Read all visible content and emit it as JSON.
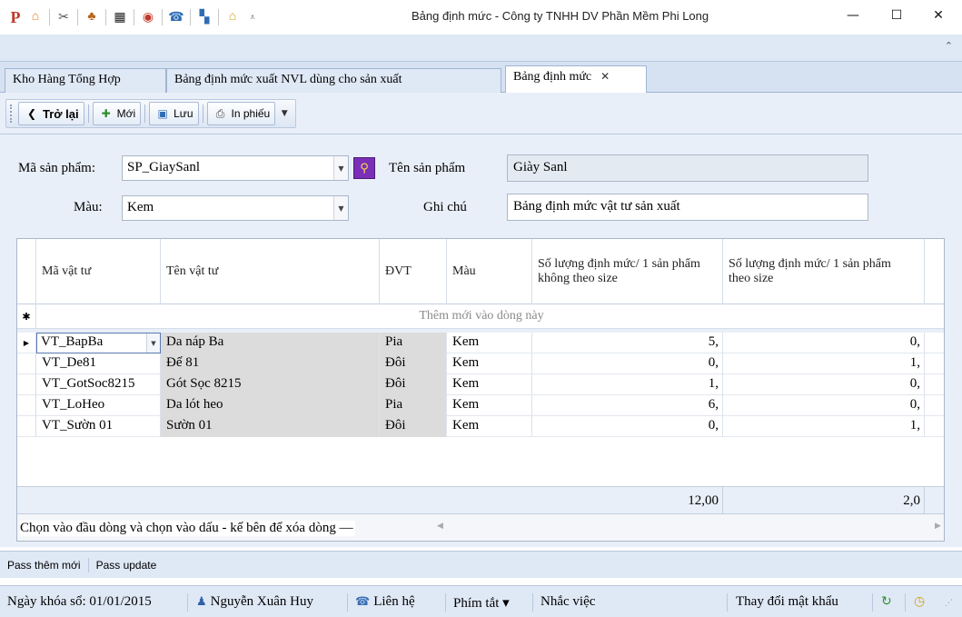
{
  "window": {
    "title": "Bảng định mức - Công ty TNHH DV Phần Mềm Phi Long",
    "minimize": "—",
    "maximize": "☐",
    "close": "✕",
    "quick_access_icons": [
      "app-logo-icon",
      "home-icon",
      "scissors-icon",
      "people-icon",
      "movie-icon",
      "eye-icon",
      "phone-icon",
      "windows-icon",
      "house-icon",
      "customize-icon"
    ]
  },
  "ribbon": {
    "collapse_glyph": "⌃"
  },
  "tabs": [
    {
      "label": "Kho Hàng Tổng Hợp",
      "active": false
    },
    {
      "label": "Bảng định mức xuất NVL dùng cho sản xuất",
      "active": false
    },
    {
      "label": "Bảng định mức",
      "active": true,
      "close": "✕"
    }
  ],
  "toolbar": {
    "back_label": "Trở lại",
    "new_label": "Mới",
    "save_label": "Lưu",
    "print_label": "In phiếu"
  },
  "form": {
    "product_code_label": "Mã sản phẩm:",
    "product_code_value": "SP_GiaySanl",
    "product_name_label": "Tên sản phẩm",
    "product_name_value": "Giày Sanl",
    "color_label": "Màu:",
    "color_value": "Kem",
    "note_label": "Ghi chú",
    "note_value": "Bảng định mức vật tư sản xuất"
  },
  "grid": {
    "columns": [
      "Mã vật tư",
      "Tên vật tư",
      "ĐVT",
      "Màu",
      "Số lượng định mức/ 1 sản phẩm không theo size",
      "Số lượng định mức/ 1 sản phẩm theo size"
    ],
    "new_row_marker": "✱",
    "new_row_text": "Thêm mới vào dòng này",
    "rows": [
      {
        "code": "VT_BapBa",
        "name": "Da náp Ba",
        "unit": "Pia",
        "color": "Kem",
        "qty_nosize": "5,",
        "qty_size": "0,"
      },
      {
        "code": "VT_De81",
        "name": "Đế 81",
        "unit": "Đôi",
        "color": "Kem",
        "qty_nosize": "0,",
        "qty_size": "1,"
      },
      {
        "code": "VT_GotSoc8215",
        "name": "Gót Sọc 8215",
        "unit": "Đôi",
        "color": "Kem",
        "qty_nosize": "1,",
        "qty_size": "0,"
      },
      {
        "code": "VT_LoHeo",
        "name": "Da lót heo",
        "unit": "Pia",
        "color": "Kem",
        "qty_nosize": "6,",
        "qty_size": "0,"
      },
      {
        "code": "VT_Sườn 01",
        "name": "Sườn 01",
        "unit": "Đôi",
        "color": "Kem",
        "qty_nosize": "0,",
        "qty_size": "1,"
      }
    ],
    "total_nosize": "12,00",
    "total_size": "2,0",
    "hint": "Chọn vào đầu dòng và chọn vào dấu - kế bên để xóa dòng",
    "hint_dash": "—"
  },
  "status_top": [
    "Pass thêm mới",
    "Pass update"
  ],
  "status_bottom": {
    "lock_date": "Ngày khóa sổ: 01/01/2015",
    "user": "Nguyễn Xuân Huy",
    "contact": "Liên hệ",
    "shortcuts": "Phím tắt ▾",
    "reminder": "Nhắc việc",
    "change_password": "Thay đổi mật khẩu"
  },
  "colors": {
    "accent": "#dfe8f5",
    "lookup_button": "#7a2fb8",
    "readonly_cell": "#dcdcdc"
  }
}
